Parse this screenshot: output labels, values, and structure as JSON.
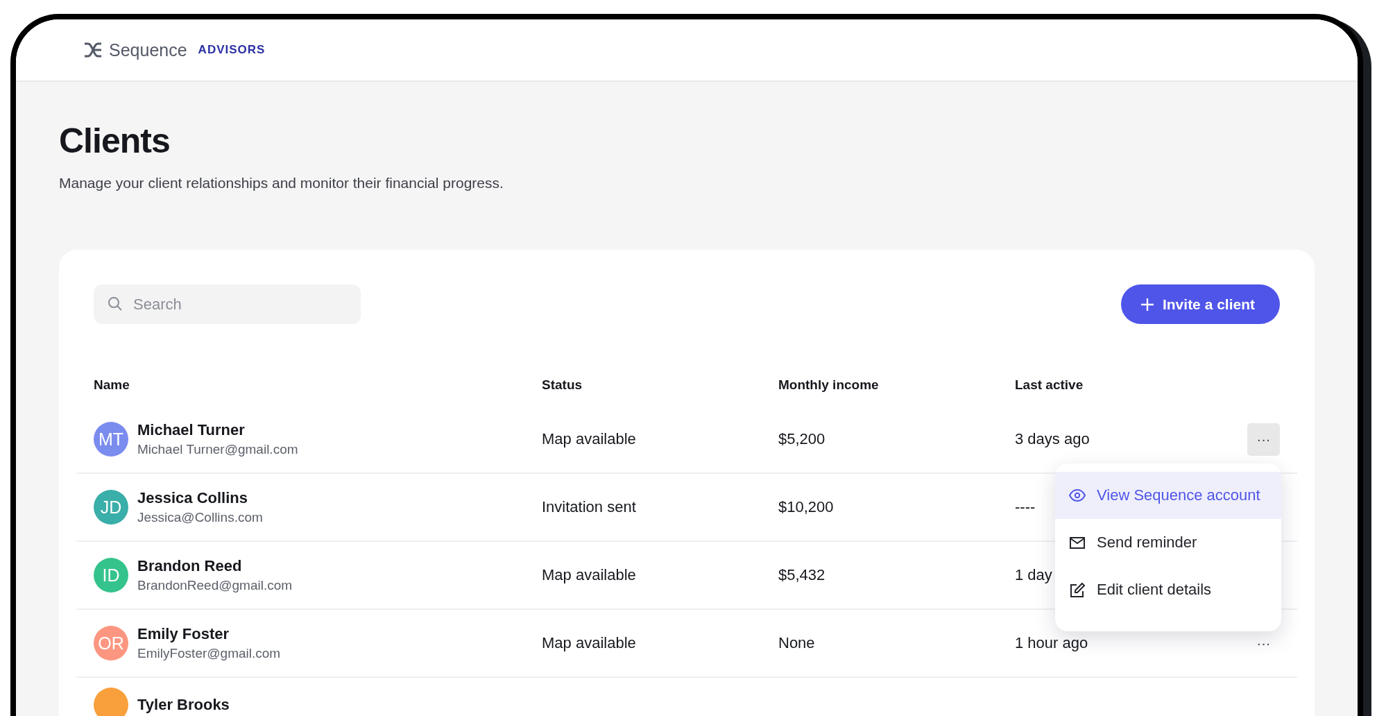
{
  "header": {
    "brand": "Sequence",
    "product": "ADVISORS"
  },
  "page": {
    "title": "Clients",
    "subtitle": "Manage your client relationships and monitor their financial progress."
  },
  "search": {
    "placeholder": "Search"
  },
  "invite_button": {
    "label": "Invite a client"
  },
  "table": {
    "columns": [
      "Name",
      "Status",
      "Monthly income",
      "Last active"
    ],
    "rows": [
      {
        "initials": "MT",
        "color": "#7b8cef",
        "name": "Michael Turner",
        "email": "Michael Turner@gmail.com",
        "status": "Map available",
        "income": "$5,200",
        "last_active": "3 days ago",
        "more_button": {
          "label": "···",
          "open": true
        }
      },
      {
        "initials": "JD",
        "color": "#3aaea8",
        "name": "Jessica Collins",
        "email": "Jessica@Collins.com",
        "status": "Invitation sent",
        "income": "$10,200",
        "last_active": "----"
      },
      {
        "initials": "ID",
        "color": "#35c38c",
        "name": "Brandon Reed",
        "email": "BrandonReed@gmail.com",
        "status": "Map available",
        "income": "$5,432",
        "last_active": "1 day"
      },
      {
        "initials": "OR",
        "color": "#fc9680",
        "name": "Emily Foster",
        "email": "EmilyFoster@gmail.com",
        "status": "Map available",
        "income": "None",
        "last_active": "1 hour ago",
        "more_button": {
          "label": "···",
          "open": false
        }
      },
      {
        "color": "#f9a03c",
        "name": "Tyler Brooks"
      }
    ]
  },
  "menu": {
    "items": [
      {
        "kind": "view",
        "label": "View Sequence account",
        "selected": true
      },
      {
        "kind": "mail",
        "label": "Send reminder",
        "selected": false
      },
      {
        "kind": "edit",
        "label": "Edit client details",
        "selected": false
      }
    ]
  }
}
